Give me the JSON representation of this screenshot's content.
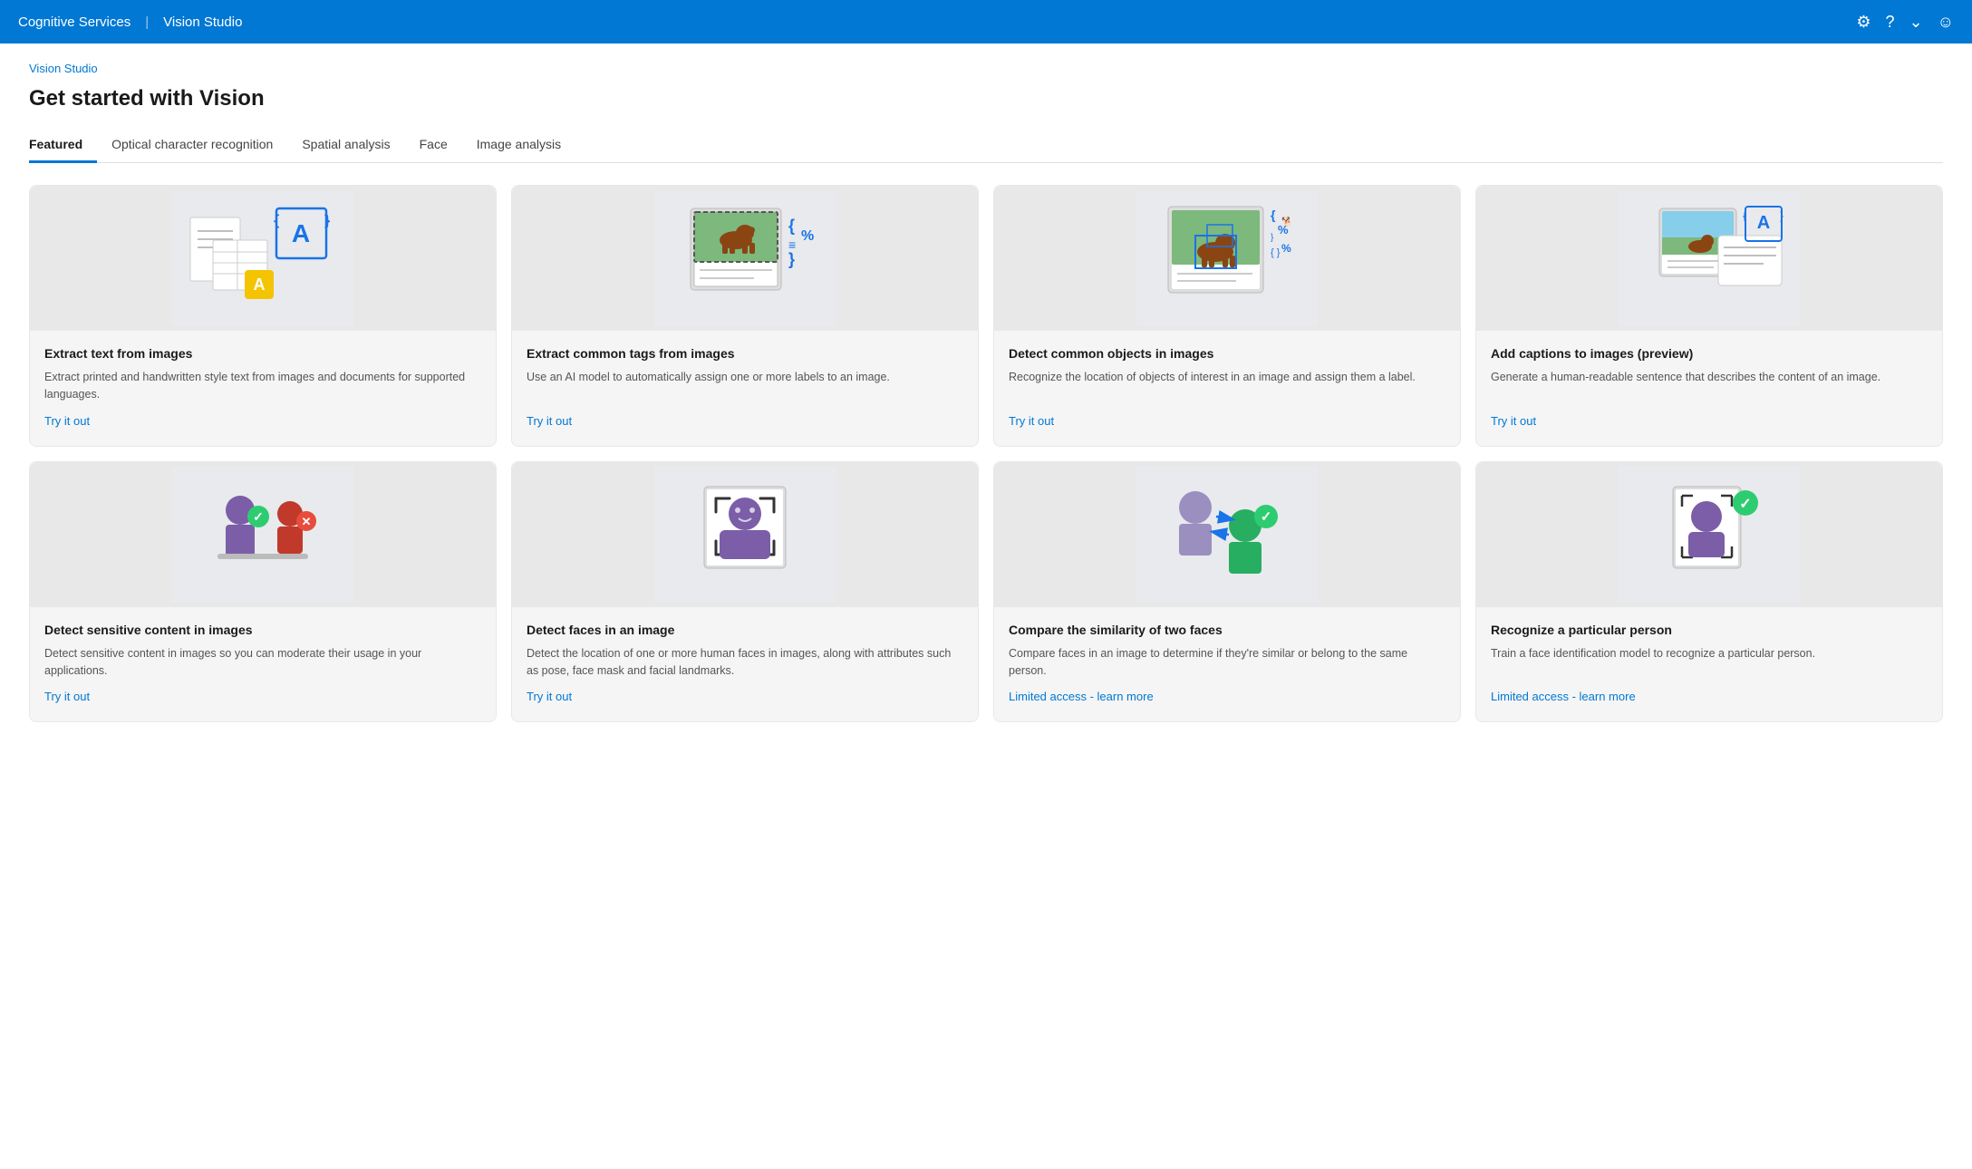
{
  "header": {
    "brand": "Cognitive Services",
    "divider": "|",
    "app": "Vision Studio",
    "icons": [
      "gear-icon",
      "help-icon",
      "chevron-down-icon",
      "user-icon"
    ]
  },
  "breadcrumb": "Vision Studio",
  "page_title": "Get started with Vision",
  "tabs": [
    {
      "id": "featured",
      "label": "Featured",
      "active": true
    },
    {
      "id": "ocr",
      "label": "Optical character recognition",
      "active": false
    },
    {
      "id": "spatial",
      "label": "Spatial analysis",
      "active": false
    },
    {
      "id": "face",
      "label": "Face",
      "active": false
    },
    {
      "id": "image",
      "label": "Image analysis",
      "active": false
    }
  ],
  "row1": [
    {
      "id": "extract-text",
      "title": "Extract text from images",
      "desc": "Extract printed and handwritten style text from images and documents for supported languages.",
      "link": "Try it out"
    },
    {
      "id": "extract-tags",
      "title": "Extract common tags from images",
      "desc": "Use an AI model to automatically assign one or more labels to an image.",
      "link": "Try it out"
    },
    {
      "id": "detect-objects",
      "title": "Detect common objects in images",
      "desc": "Recognize the location of objects of interest in an image and assign them a label.",
      "link": "Try it out"
    },
    {
      "id": "add-captions",
      "title": "Add captions to images (preview)",
      "desc": "Generate a human-readable sentence that describes the content of an image.",
      "link": "Try it out"
    }
  ],
  "row2": [
    {
      "id": "detect-sensitive",
      "title": "Detect sensitive content in images",
      "desc": "Detect sensitive content in images so you can moderate their usage in your applications.",
      "link": "Try it out",
      "link_type": "normal"
    },
    {
      "id": "detect-faces",
      "title": "Detect faces in an image",
      "desc": "Detect the location of one or more human faces in images, along with attributes such as pose, face mask and facial landmarks.",
      "link": "Try it out",
      "link_type": "normal"
    },
    {
      "id": "compare-faces",
      "title": "Compare the similarity of two faces",
      "desc": "Compare faces in an image to determine if they're similar or belong to the same person.",
      "link": "Limited access - learn more",
      "link_type": "limited"
    },
    {
      "id": "recognize-person",
      "title": "Recognize a particular person",
      "desc": "Train a face identification model to recognize a particular person.",
      "link": "Limited access - learn more",
      "link_type": "limited"
    }
  ]
}
